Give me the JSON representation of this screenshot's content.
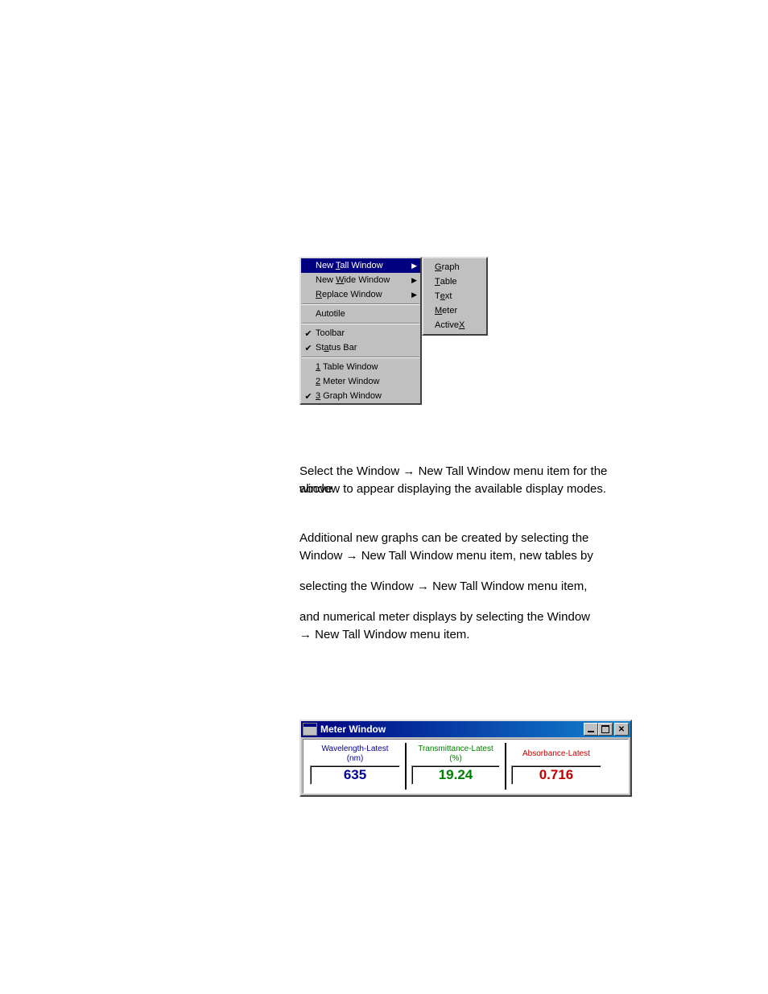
{
  "menu": {
    "main": [
      {
        "label": "New <u>T</u>all Window",
        "arrow": true,
        "highlighted": true
      },
      {
        "label": "New <u>W</u>ide Window",
        "arrow": true
      },
      {
        "label": "<u>R</u>eplace Window",
        "arrow": true
      },
      {
        "separator": true
      },
      {
        "label": "Autotile"
      },
      {
        "separator": true
      },
      {
        "label": "Toolbar",
        "checked": true
      },
      {
        "label": "St<u>a</u>tus Bar",
        "checked": true
      },
      {
        "separator": true
      },
      {
        "label": "<u>1</u> Table  Window"
      },
      {
        "label": "<u>2</u> Meter  Window"
      },
      {
        "label": "<u>3</u> Graph Window",
        "checked": true
      }
    ],
    "sub": [
      {
        "label": "<u>G</u>raph"
      },
      {
        "label": "<u>T</u>able"
      },
      {
        "label": "T<u>e</u>xt"
      },
      {
        "label": "<u>M</u>eter"
      },
      {
        "label": "Active<u>X</u>"
      }
    ]
  },
  "text": {
    "p1_a": "Select the Window ",
    "p1_b": " New Tall Window menu item for the above",
    "p2": "window to appear displaying the available display modes.",
    "p3": "Additional new graphs can be created by selecting the",
    "p4_a": "Window ",
    "p4_b": " New Tall Window menu item, new tables by",
    "p5_a": "selecting the Window ",
    "p5_b": " New Tall Window menu item,",
    "p6": "and numerical meter displays by selecting the Window",
    "p7": "New Tall Window menu item.",
    "arrow": "→"
  },
  "meter": {
    "title": "Meter  Window",
    "cells": [
      {
        "label1": "Wavelength-Latest",
        "label2": "(nm)",
        "value": "635",
        "colorClass": "c-blue"
      },
      {
        "label1": "Transmittance-Latest",
        "label2": "(%)",
        "value": "19.24",
        "colorClass": "c-green"
      },
      {
        "label1": "Absorbance-Latest",
        "label2": "",
        "value": "0.716",
        "colorClass": "c-red"
      }
    ]
  }
}
